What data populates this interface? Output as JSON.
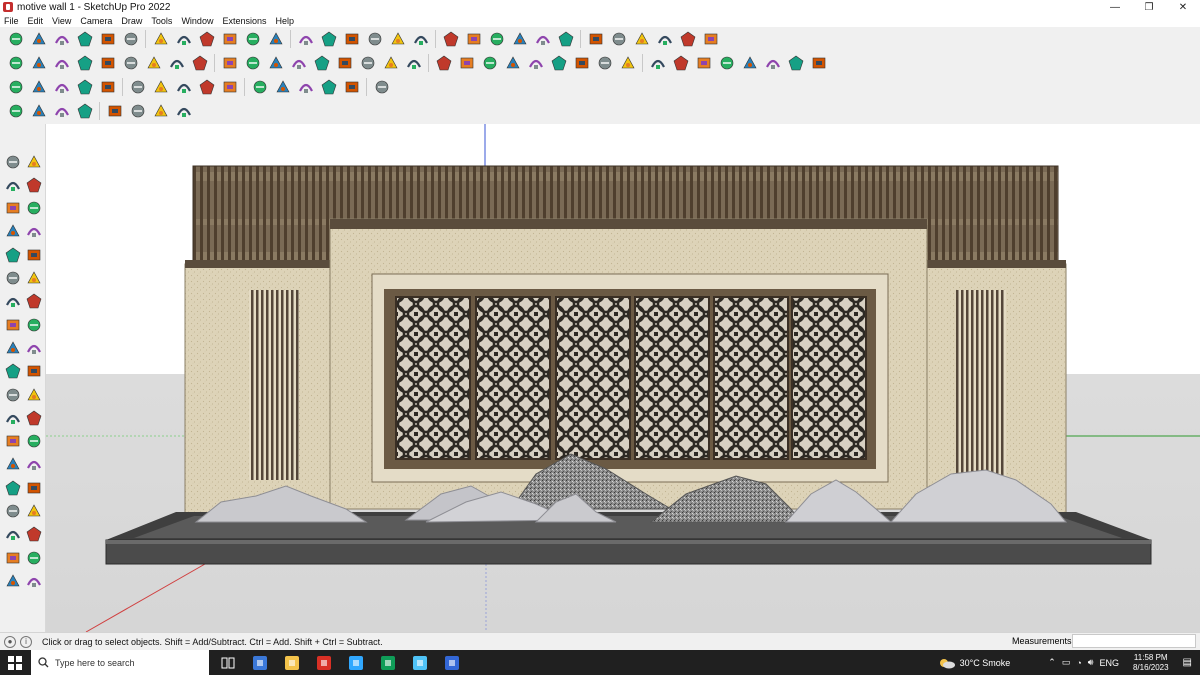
{
  "window": {
    "title": "motive wall 1 - SketchUp Pro 2022",
    "minimize": "—",
    "restore": "❐",
    "close": "✕"
  },
  "menu": [
    "File",
    "Edit",
    "View",
    "Camera",
    "Draw",
    "Tools",
    "Window",
    "Extensions",
    "Help"
  ],
  "toolbars": {
    "row1_icons": [
      "search-icon",
      "select-icon",
      "eraser-icon",
      "pencil-icon",
      "arc-icon",
      "paint-bucket-icon",
      "push-pull-icon",
      "orbit-icon",
      "move-icon",
      "rotate-icon",
      "scale-icon",
      "tape-icon",
      "text-icon",
      "paint-icon",
      "orbit-icon",
      "zoom-icon",
      "zoom-extents-icon",
      "components-icon",
      "layers-icon",
      "materials-icon",
      "geo-icon",
      "warehouse-icon",
      "extension-icon",
      "section-icon",
      "front-view-icon",
      "iso-view-icon",
      "top-view-icon",
      "undo-icon",
      "redo-icon",
      "solid-tools-icon"
    ],
    "row2_icons": [
      "box-icon",
      "sandbox-icon",
      "follow-me-icon",
      "cube-icon",
      "intersect-icon",
      "union-icon",
      "subtract-icon",
      "trim-icon",
      "split-icon",
      "outer-shell-icon",
      "curve-icon",
      "flip-icon",
      "offset-icon",
      "house-icon",
      "shapes-icon",
      "roof-icon",
      "wall-icon",
      "stairs-icon",
      "window-icon",
      "door-icon",
      "cone-icon",
      "sphere-icon",
      "torus-icon",
      "profile-icon",
      "grid-icon",
      "fillet-icon",
      "chamfer-icon",
      "helix-icon",
      "loft-icon",
      "skin-icon",
      "extrude-icon",
      "layout-icon",
      "label-icon",
      "texture-icon",
      "material-icon"
    ],
    "row3_icons": [
      "bezier-icon",
      "spline-icon",
      "polyline-icon",
      "rectangle-icon",
      "polygon-icon",
      "text3d-icon",
      "weld-icon",
      "explode-icon",
      "group-icon",
      "component-icon",
      "mirror-icon",
      "array-icon",
      "align-icon",
      "distribute-icon",
      "snap-icon",
      "measure-icon"
    ],
    "row4_icons": [
      "path-icon",
      "curve-icon",
      "copy-icon",
      "tile-icon",
      "frame-icon",
      "panel-icon",
      "louver-icon",
      "pattern-icon"
    ]
  },
  "left_toolbar_icons": [
    "select-icon",
    "orbit-icon",
    "paint-bucket-icon",
    "eraser-icon",
    "components-icon",
    "pencil-icon",
    "line-icon",
    "freehand-icon",
    "rectangle-icon",
    "rotated-rectangle-icon",
    "circle-icon",
    "polygon-icon",
    "arc-icon",
    "pie-icon",
    "offset-icon",
    "move-icon",
    "push-pull-icon",
    "rotate-icon",
    "follow-me-icon",
    "scale-icon",
    "tape-measure-icon",
    "dimension-icon",
    "protractor-icon",
    "text-icon",
    "axes-icon",
    "3d-text-icon",
    "orbit-icon",
    "pan-icon",
    "zoom-icon",
    "zoom-window-icon",
    "zoom-extents-icon",
    "previous-view-icon",
    "position-camera-icon",
    "look-around-icon",
    "walk-icon",
    "section-plane-icon",
    "sandbox-icon",
    "smoove-icon"
  ],
  "status": {
    "hint": "Click or drag to select objects. Shift = Add/Subtract. Ctrl = Add. Shift + Ctrl = Subtract.",
    "measurements_label": "Measurements",
    "measurements_value": ""
  },
  "taskbar": {
    "search_placeholder": "Type here to search",
    "apps": [
      "task-view-icon",
      "calculator-icon",
      "file-explorer-icon",
      "acrobat-icon",
      "photoshop-icon",
      "edge-icon",
      "photos-icon",
      "sketchup-icon"
    ],
    "weather": "30°C Smoke",
    "language": "ENG",
    "time": "11:58 PM",
    "date": "8/16/2023"
  },
  "colors": {
    "wall_stone": "#ddd3b8",
    "wood_slats": "#5d4c39",
    "screen_frame": "#6b5a44",
    "base_dark": "#4a4a4a",
    "rock_light": "#c8c8cc",
    "accent_blue": "#0078d7",
    "axis_red": "#d04040",
    "axis_green": "#2e9a2e"
  }
}
